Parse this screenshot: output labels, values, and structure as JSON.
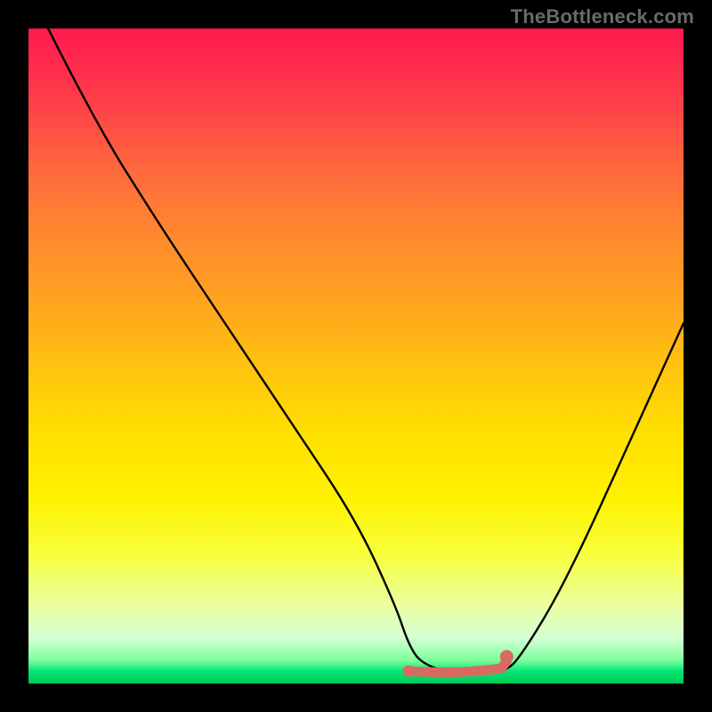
{
  "watermark": "TheBottleneck.com",
  "colors": {
    "frame_bg": "#000000",
    "curve": "#000000",
    "highlight": "#d96a62",
    "gradient_top": "#ff1a4f",
    "gradient_bottom": "#00c853"
  },
  "chart_data": {
    "type": "line",
    "title": "",
    "xlabel": "",
    "ylabel": "",
    "xlim": [
      0,
      100
    ],
    "ylim": [
      0,
      100
    ],
    "grid": false,
    "legend": false,
    "series": [
      {
        "name": "bottleneck-curve",
        "color": "#000000",
        "x": [
          3,
          10,
          20,
          30,
          40,
          50,
          56,
          58,
          60,
          65,
          70,
          73,
          75,
          80,
          85,
          90,
          95,
          100
        ],
        "values": [
          100,
          86,
          70,
          55,
          40,
          25,
          12,
          6,
          3,
          1.5,
          1.5,
          2,
          4,
          12,
          22,
          33,
          44,
          55
        ]
      }
    ],
    "annotations": [
      {
        "name": "optimal-range-marker",
        "color": "#d96a62",
        "shape": "thick-segment",
        "x_start": 58,
        "x_end": 73,
        "y": 1.5
      },
      {
        "name": "optimal-end-dot",
        "color": "#d96a62",
        "shape": "dot",
        "x": 73,
        "y": 3
      }
    ]
  }
}
